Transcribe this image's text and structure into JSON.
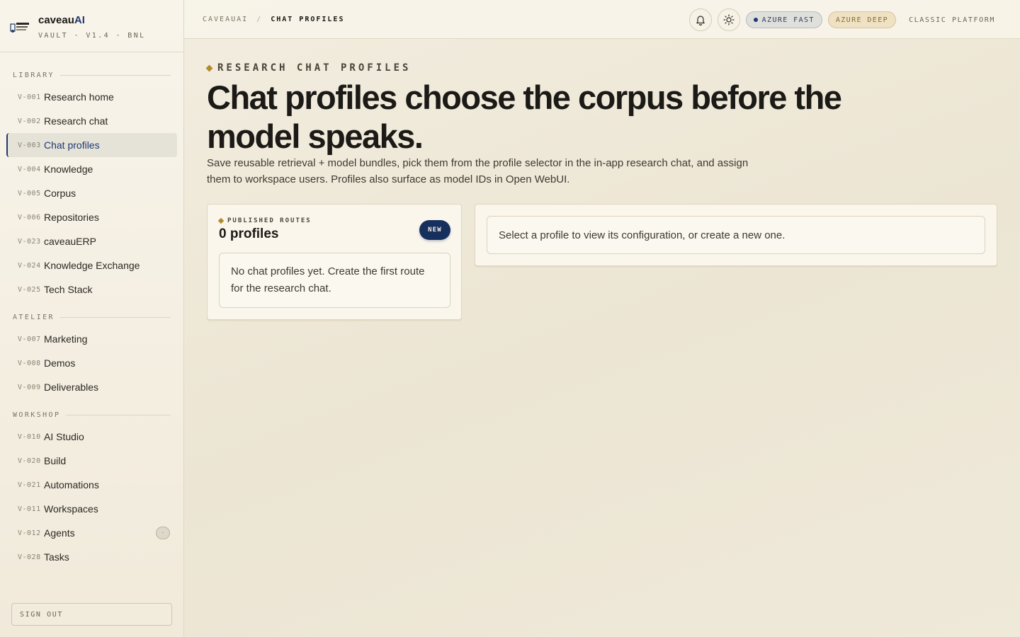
{
  "brand": {
    "name_main": "caveau",
    "name_accent": "AI",
    "subtitle": "VAULT · V1.4 · BNL",
    "logo_icon": "vault-logo-icon"
  },
  "sidebar": {
    "sections": [
      {
        "label": "LIBRARY",
        "items": [
          {
            "code": "V-001",
            "label": "Research home"
          },
          {
            "code": "V-002",
            "label": "Research chat"
          },
          {
            "code": "V-003",
            "label": "Chat profiles",
            "active": true
          },
          {
            "code": "V-004",
            "label": "Knowledge"
          },
          {
            "code": "V-005",
            "label": "Corpus"
          },
          {
            "code": "V-006",
            "label": "Repositories"
          },
          {
            "code": "V-023",
            "label": "caveauERP"
          },
          {
            "code": "V-024",
            "label": "Knowledge Exchange"
          },
          {
            "code": "V-025",
            "label": "Tech Stack"
          }
        ]
      },
      {
        "label": "ATELIER",
        "items": [
          {
            "code": "V-007",
            "label": "Marketing"
          },
          {
            "code": "V-008",
            "label": "Demos"
          },
          {
            "code": "V-009",
            "label": "Deliverables"
          }
        ]
      },
      {
        "label": "WORKSHOP",
        "items": [
          {
            "code": "V-010",
            "label": "AI Studio"
          },
          {
            "code": "V-020",
            "label": "Build"
          },
          {
            "code": "V-021",
            "label": "Automations"
          },
          {
            "code": "V-011",
            "label": "Workspaces"
          },
          {
            "code": "V-012",
            "label": "Agents",
            "badge": "·"
          },
          {
            "code": "V-028",
            "label": "Tasks"
          }
        ]
      }
    ],
    "signout_label": "SIGN OUT"
  },
  "header": {
    "breadcrumb": [
      "CAVEAUAI",
      "CHAT PROFILES"
    ],
    "breadcrumb_sep": "/",
    "notification_icon": "bell-icon",
    "theme_icon": "sun-icon",
    "model_fast_label": "AZURE FAST",
    "model_deep_label": "AZURE DEEP",
    "classic_label": "CLASSIC PLATFORM"
  },
  "main": {
    "eyebrow": "RESEARCH CHAT PROFILES",
    "headline": "Chat profiles choose the corpus before the model speaks.",
    "lede": "Save reusable retrieval + model bundles, pick them from the profile selector in the in-app research chat, and assign them to workspace users. Profiles also surface as model IDs in Open WebUI.",
    "routes_card": {
      "eyebrow": "PUBLISHED ROUTES",
      "count": "0 profiles",
      "new_label": "NEW",
      "empty_text": "No chat profiles yet. Create the first route for the research chat."
    },
    "detail_card": {
      "placeholder_text": "Select a profile to view its configuration, or create a new one."
    }
  },
  "colors": {
    "accent_navy": "#1e3a70",
    "accent_gold": "#b58a2c",
    "background": "#efe9da"
  }
}
